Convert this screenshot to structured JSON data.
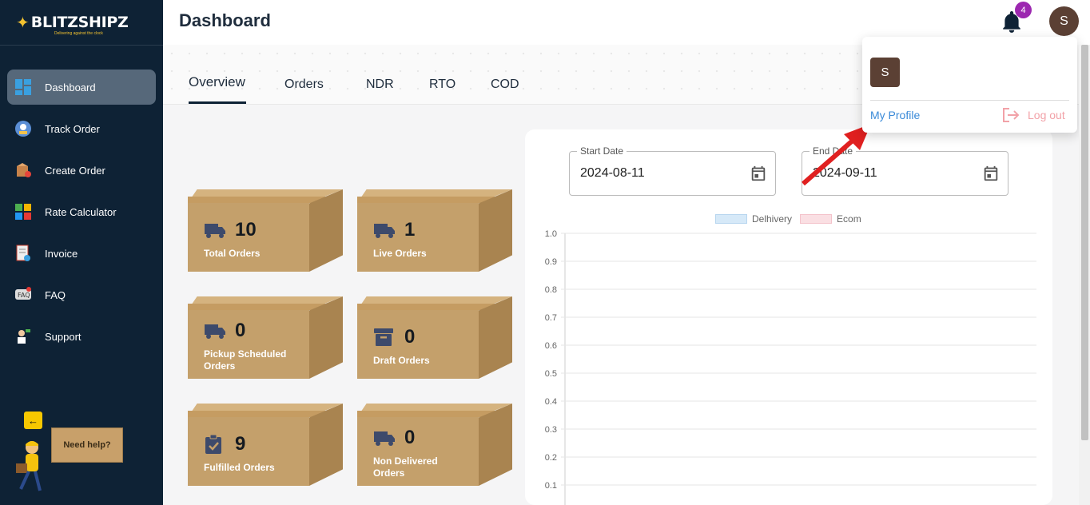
{
  "brand": {
    "name": "BLITZSHIPZ",
    "tagline": "Delivering against the clock"
  },
  "sidebar": {
    "items": [
      {
        "label": "Dashboard",
        "icon": "dashboard-icon",
        "active": true
      },
      {
        "label": "Track Order",
        "icon": "track-order-icon"
      },
      {
        "label": "Create Order",
        "icon": "create-order-icon"
      },
      {
        "label": "Rate Calculator",
        "icon": "calculator-icon"
      },
      {
        "label": "Invoice",
        "icon": "invoice-icon"
      },
      {
        "label": "FAQ",
        "icon": "faq-icon"
      },
      {
        "label": "Support",
        "icon": "support-icon"
      }
    ],
    "help": {
      "back_glyph": "←",
      "label": "Need help?"
    }
  },
  "header": {
    "title": "Dashboard",
    "notification_count": "4",
    "avatar_initial": "S"
  },
  "tabs": [
    {
      "label": "Overview",
      "active": true
    },
    {
      "label": "Orders"
    },
    {
      "label": "NDR"
    },
    {
      "label": "RTO"
    },
    {
      "label": "COD"
    }
  ],
  "cards": [
    {
      "value": "10",
      "label": "Total Orders",
      "icon": "truck-icon"
    },
    {
      "value": "1",
      "label": "Live Orders",
      "icon": "truck-icon"
    },
    {
      "value": "0",
      "label": "Pickup Scheduled Orders",
      "icon": "truck-icon"
    },
    {
      "value": "0",
      "label": "Draft Orders",
      "icon": "archive-icon"
    },
    {
      "value": "9",
      "label": "Fulfilled Orders",
      "icon": "clipboard-check-icon"
    },
    {
      "value": "0",
      "label": "Non Delivered Orders",
      "icon": "truck-icon"
    }
  ],
  "filters": {
    "start": {
      "label": "Start Date",
      "value": "2024-08-11"
    },
    "end": {
      "label": "End Date",
      "value": "2024-09-11"
    }
  },
  "dropdown": {
    "avatar_initial": "S",
    "profile_label": "My Profile",
    "logout_label": "Log out"
  },
  "colors": {
    "sidebar": "#0e2235",
    "accent_link": "#3a8ad8",
    "logout": "#f2a2a8",
    "badge": "#9c27b0",
    "box": "#c4a06b"
  },
  "chart_data": {
    "type": "bar",
    "categories": [],
    "series": [
      {
        "name": "Delhivery",
        "values": [],
        "color": "#d6e9f8"
      },
      {
        "name": "Ecom",
        "values": [],
        "color": "#fadfe3"
      }
    ],
    "ylim": [
      0,
      1.0
    ],
    "yticks": [
      "1.0",
      "0.9",
      "0.8",
      "0.7",
      "0.6",
      "0.5",
      "0.4",
      "0.3",
      "0.2",
      "0.1"
    ],
    "legend": "top",
    "grid": true
  }
}
